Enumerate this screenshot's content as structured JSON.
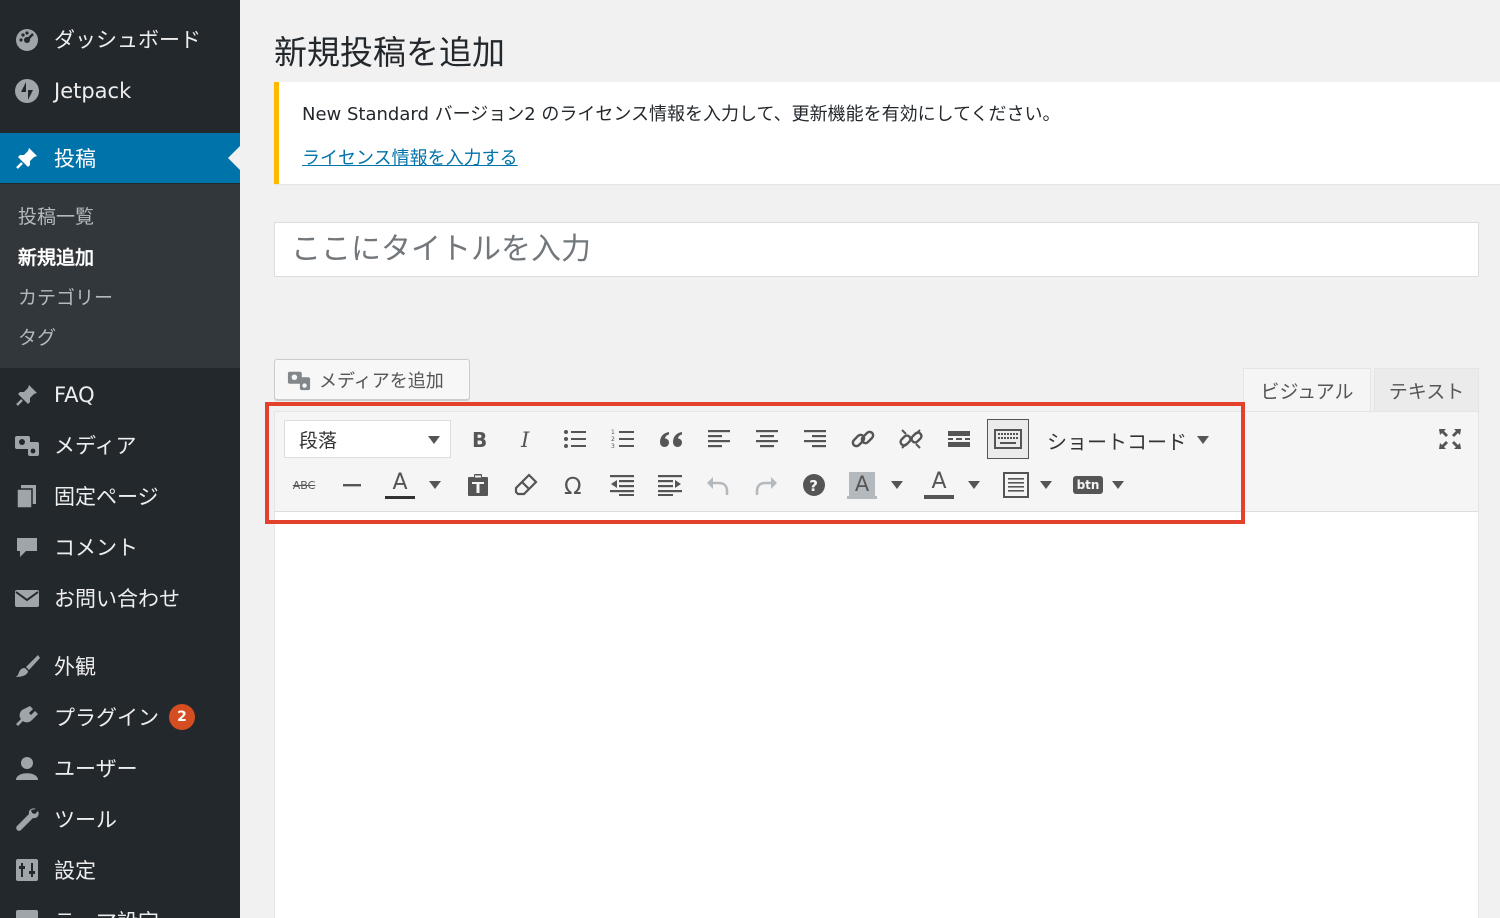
{
  "colors": {
    "sidebar_bg": "#23282d",
    "sidebar_active": "#0073aa",
    "notice_border": "#ffb900",
    "badge": "#d54e21",
    "highlight": "#e3412b",
    "link": "#0073aa"
  },
  "sidebar": {
    "items": [
      {
        "label": "ダッシュボード",
        "icon": "dashboard-icon"
      },
      {
        "label": "Jetpack",
        "icon": "jetpack-icon"
      },
      {
        "label": "投稿",
        "icon": "pin-icon",
        "active": true
      },
      {
        "label": "FAQ",
        "icon": "pin-icon"
      },
      {
        "label": "メディア",
        "icon": "media-icon"
      },
      {
        "label": "固定ページ",
        "icon": "pages-icon"
      },
      {
        "label": "コメント",
        "icon": "comment-icon"
      },
      {
        "label": "お問い合わせ",
        "icon": "mail-icon"
      },
      {
        "label": "外観",
        "icon": "brush-icon"
      },
      {
        "label": "プラグイン",
        "icon": "plugin-icon",
        "badge": "2"
      },
      {
        "label": "ユーザー",
        "icon": "user-icon"
      },
      {
        "label": "ツール",
        "icon": "wrench-icon"
      },
      {
        "label": "設定",
        "icon": "settings-icon"
      },
      {
        "label": "テーマ設定",
        "icon": "settings-icon"
      }
    ],
    "submenu": [
      {
        "label": "投稿一覧"
      },
      {
        "label": "新規追加",
        "current": true
      },
      {
        "label": "カテゴリー"
      },
      {
        "label": "タグ"
      }
    ]
  },
  "page": {
    "title": "新規投稿を追加"
  },
  "notice": {
    "message": "New Standard バージョン2 のライセンス情報を入力して、更新機能を有効にしてください。",
    "link": "ライセンス情報を入力する"
  },
  "post": {
    "title_placeholder": "ここにタイトルを入力"
  },
  "editor": {
    "add_media": "メディアを追加",
    "tab_visual": "ビジュアル",
    "tab_text": "テキスト",
    "format_value": "段落",
    "shortcode_label": "ショートコード",
    "strikethrough_label": "ABC",
    "text_color_label": "A",
    "bg_color_label": "A",
    "font_color_label": "A",
    "btn_label": "btn"
  }
}
